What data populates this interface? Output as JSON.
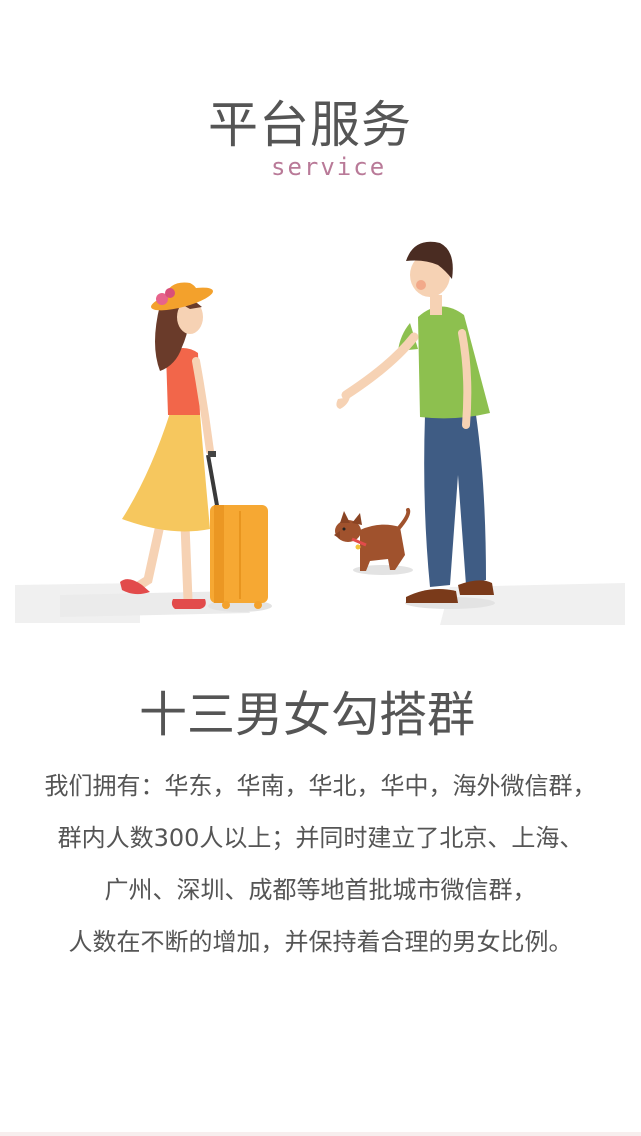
{
  "header": {
    "title": "平台服务",
    "subtitle": "service"
  },
  "illustration": {
    "icon": "couple-with-dog-illustration",
    "colors": {
      "woman_hat": "#f3a12c",
      "woman_top": "#f2664a",
      "woman_skirt": "#f6c75e",
      "suitcase": "#f6a833",
      "man_shirt": "#8dc04f",
      "man_pants": "#3f5c84",
      "dog": "#a0522d",
      "skin": "#f6d2b4",
      "hair": "#5a3a2a"
    }
  },
  "section": {
    "heading": "十三男女勾搭群",
    "lines": [
      "我们拥有：华东，华南，华北，华中，海外微信群，",
      "群内人数300人以上；并同时建立了北京、上海、",
      "广州、深圳、成都等地首批城市微信群，",
      "人数在不断的增加，并保持着合理的男女比例。"
    ]
  }
}
